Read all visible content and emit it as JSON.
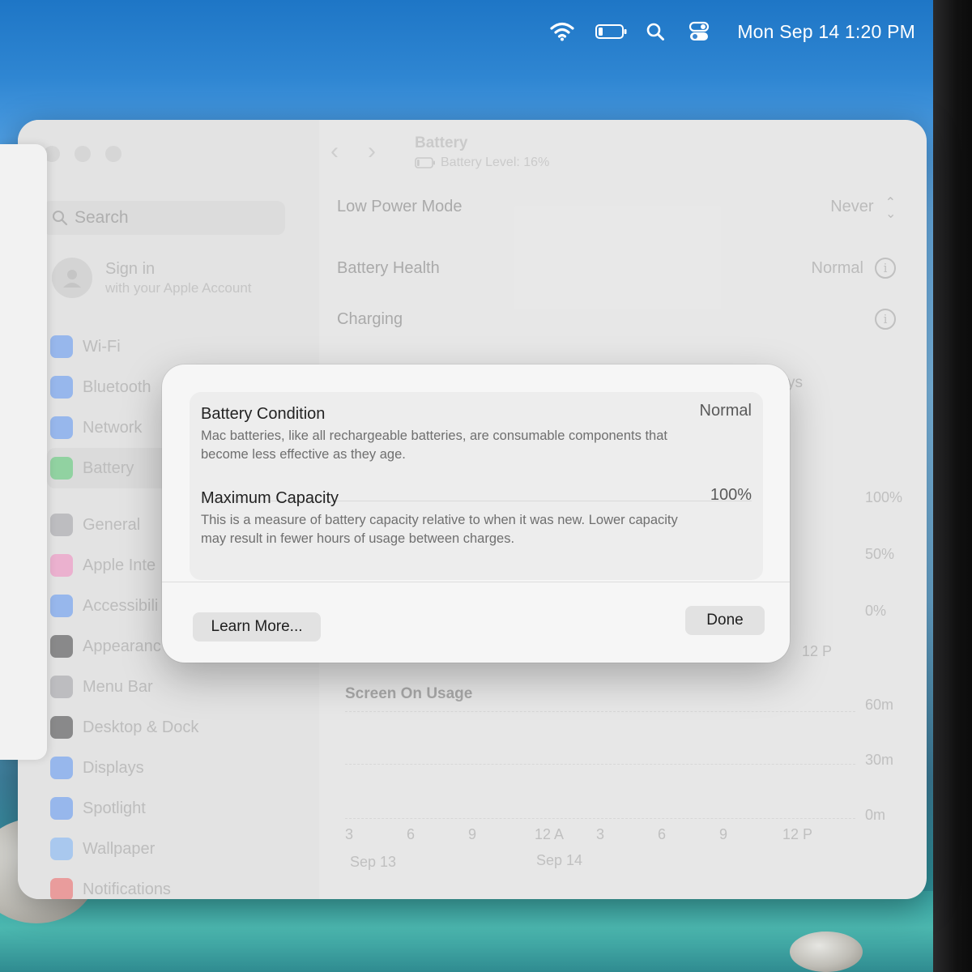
{
  "menubar": {
    "icons": [
      "wifi-icon",
      "battery-icon",
      "search-icon",
      "control-center-icon"
    ],
    "clock": "Mon Sep 14  1:20 PM"
  },
  "window": {
    "title": "Battery",
    "subtitle": "Battery Level: 16%",
    "battery_level": 0.16
  },
  "sidebar": {
    "search_placeholder": "Search",
    "signin": {
      "title": "Sign in",
      "subtitle": "with your Apple Account"
    },
    "items": [
      {
        "label": "Wi-Fi",
        "icon": "wifi-icon",
        "color": "#3b82f6"
      },
      {
        "label": "Bluetooth",
        "icon": "bluetooth-icon",
        "color": "#3b82f6"
      },
      {
        "label": "Network",
        "icon": "globe-icon",
        "color": "#3b82f6"
      },
      {
        "label": "Battery",
        "icon": "battery-icon",
        "color": "#34c759"
      },
      {
        "label": "General",
        "icon": "gear-icon",
        "color": "#8e8e93"
      },
      {
        "label": "Apple Inte",
        "icon": "apple-intelligence-icon",
        "color": "#f472b6"
      },
      {
        "label": "Accessibili",
        "icon": "accessibility-icon",
        "color": "#3b82f6"
      },
      {
        "label": "Appearanc",
        "icon": "appearance-icon",
        "color": "#1c1c1e"
      },
      {
        "label": "Menu Bar",
        "icon": "menu-bar-icon",
        "color": "#8e8e93"
      },
      {
        "label": "Desktop & Dock",
        "icon": "dock-icon",
        "color": "#1c1c1e"
      },
      {
        "label": "Displays",
        "icon": "sun-icon",
        "color": "#3b82f6"
      },
      {
        "label": "Spotlight",
        "icon": "spotlight-icon",
        "color": "#3b82f6"
      },
      {
        "label": "Wallpaper",
        "icon": "wallpaper-icon",
        "color": "#60a5fa"
      },
      {
        "label": "Notifications",
        "icon": "notifications-icon",
        "color": "#ef4444"
      }
    ]
  },
  "settings": {
    "low_power_mode": {
      "label": "Low Power Mode",
      "value": "Never"
    },
    "battery_health": {
      "label": "Battery Health",
      "value": "Normal"
    },
    "charging": {
      "label": "Charging"
    },
    "partial_text": "ys"
  },
  "charts": {
    "level_axis": [
      "100%",
      "50%",
      "0%"
    ],
    "level_time_label": "12 P",
    "usage_title": "Screen On Usage",
    "usage_axis": [
      "60m",
      "30m",
      "0m"
    ],
    "x_ticks": [
      "3",
      "6",
      "9",
      "12 A",
      "3",
      "6",
      "9",
      "12 P"
    ],
    "dates": [
      "Sep 13",
      "Sep 14"
    ]
  },
  "sheet": {
    "condition": {
      "label": "Battery Condition",
      "value": "Normal",
      "description": "Mac batteries, like all rechargeable batteries, are consumable components that become less effective as they age."
    },
    "capacity": {
      "label": "Maximum Capacity",
      "value": "100%",
      "description": "This is a measure of battery capacity relative to when it was new. Lower capacity may result in fewer hours of usage between charges."
    },
    "learn_more": "Learn More...",
    "done": "Done"
  }
}
